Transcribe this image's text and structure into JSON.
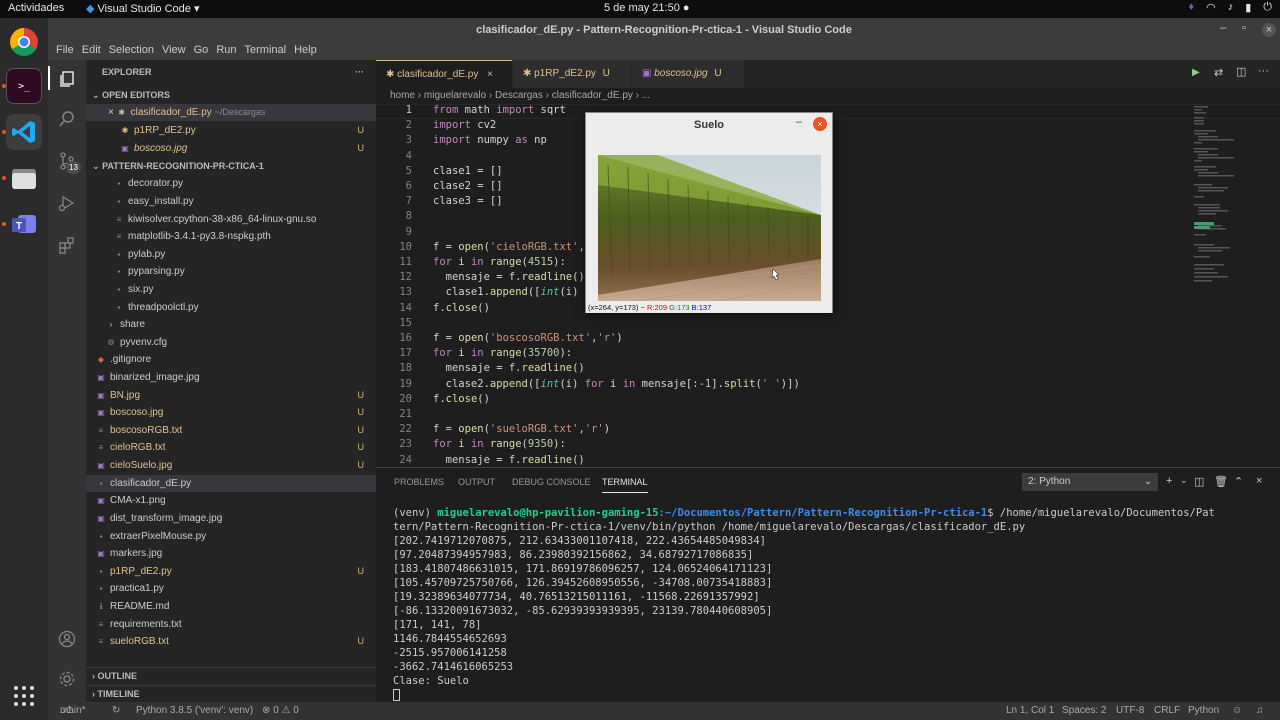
{
  "system": {
    "activities": "Actividades",
    "app_menu": "Visual Studio Code",
    "clock": "5 de may  21:50"
  },
  "window": {
    "title": "clasificador_dE.py - Pattern-Recognition-Pr-ctica-1 - Visual Studio Code"
  },
  "menu": [
    "File",
    "Edit",
    "Selection",
    "View",
    "Go",
    "Run",
    "Terminal",
    "Help"
  ],
  "sidebar": {
    "header": "EXPLORER",
    "open_editors_label": "OPEN EDITORS",
    "open_editors": [
      {
        "name": "clasificador_dE.py",
        "path": "~/Descargas"
      },
      {
        "name": "p1RP_dE2.py",
        "badge": "U"
      },
      {
        "name": "boscoso.jpg",
        "badge": "U"
      }
    ],
    "folder_label": "PATTERN-RECOGNITION-PR-CTICA-1",
    "files": [
      {
        "name": "decorator.py"
      },
      {
        "name": "easy_install.py"
      },
      {
        "name": "kiwisolver.cpython-38-x86_64-linux-gnu.so"
      },
      {
        "name": "matplotlib-3.4.1-py3.8-nspkg.pth"
      },
      {
        "name": "pylab.py"
      },
      {
        "name": "pyparsing.py"
      },
      {
        "name": "six.py"
      },
      {
        "name": "threadpoolctl.py"
      },
      {
        "name": "share"
      },
      {
        "name": "pyvenv.cfg"
      },
      {
        "name": ".gitignore"
      },
      {
        "name": "binarized_image.jpg"
      },
      {
        "name": "BN.jpg",
        "badge": "U"
      },
      {
        "name": "boscoso.jpg",
        "badge": "U"
      },
      {
        "name": "boscosoRGB.txt",
        "badge": "U"
      },
      {
        "name": "cieloRGB.txt",
        "badge": "U"
      },
      {
        "name": "cieloSuelo.jpg",
        "badge": "U"
      },
      {
        "name": "clasificador_dE.py"
      },
      {
        "name": "CMA-x1.png"
      },
      {
        "name": "dist_transform_image.jpg"
      },
      {
        "name": "extraerPixelMouse.py"
      },
      {
        "name": "markers.jpg"
      },
      {
        "name": "p1RP_dE2.py",
        "badge": "U"
      },
      {
        "name": "practica1.py"
      },
      {
        "name": "README.md"
      },
      {
        "name": "requirements.txt"
      },
      {
        "name": "sueloRGB.txt",
        "badge": "U"
      }
    ],
    "outline": "OUTLINE",
    "timeline": "TIMELINE",
    "scm_badge": "13"
  },
  "tabs": [
    {
      "label": "clasificador_dE.py",
      "suffix": "×"
    },
    {
      "label": "p1RP_dE2.py",
      "suffix": "U"
    },
    {
      "label": "boscoso.jpg",
      "suffix": "U"
    }
  ],
  "breadcrumb": "home  ›  miguelarevalo  ›  Descargas  ›  clasificador_dE.py  ›  ...",
  "editor": {
    "line_numbers": [
      "1",
      "2",
      "3",
      "4",
      "5",
      "6",
      "7",
      "8",
      "9",
      "10",
      "11",
      "12",
      "13",
      "14",
      "15",
      "16",
      "17",
      "18",
      "19",
      "20",
      "21",
      "22",
      "23",
      "24"
    ]
  },
  "image_window": {
    "title": "Suelo",
    "status_prefix": "(x=264, y=173) ~ ",
    "r": "R:209",
    "g": "G:173",
    "b": "B:137"
  },
  "panel": {
    "tabs": [
      "PROBLEMS",
      "OUTPUT",
      "DEBUG CONSOLE",
      "TERMINAL"
    ],
    "terminal_select": "2: Python",
    "prompt_venv": "(venv) ",
    "prompt_user": "miguelarevalo@hp-pavilion-gaming-15",
    "prompt_path": ":~/Documentos/Pattern/Pattern-Recognition-Pr-ctica-1",
    "prompt_cmd": "$ /home/miguelarevalo/Documentos/Pat",
    "lines": [
      "tern/Pattern-Recognition-Pr-ctica-1/venv/bin/python /home/miguelarevalo/Descargas/clasificador_dE.py",
      "[202.7419712070875, 212.63433001107418, 222.43654485049834]",
      "[97.20487394957983, 86.23980392156862, 34.68792717086835]",
      "[183.41807486631015, 171.86919786096257, 124.06524064171123]",
      "[105.45709725750766, 126.39452608950556, -34708.00735418883]",
      "[19.32389634077734, 40.76513215011161, -11568.22691357992]",
      "[-86.13320091673032, -85.62939393939395, 23139.780440608905]",
      "[171, 141, 78]",
      "1146.7844554652693",
      "-2515.957006141258",
      "-3662.7414616065253",
      "Clase: Suelo"
    ]
  },
  "status": {
    "branch": "main*",
    "python": "Python 3.8.5 ('venv': venv)",
    "problems": "⊗ 0 ⚠ 0",
    "position": "Ln 1, Col 1",
    "spaces": "Spaces: 2",
    "encoding": "UTF-8",
    "eol": "CRLF",
    "language": "Python"
  }
}
